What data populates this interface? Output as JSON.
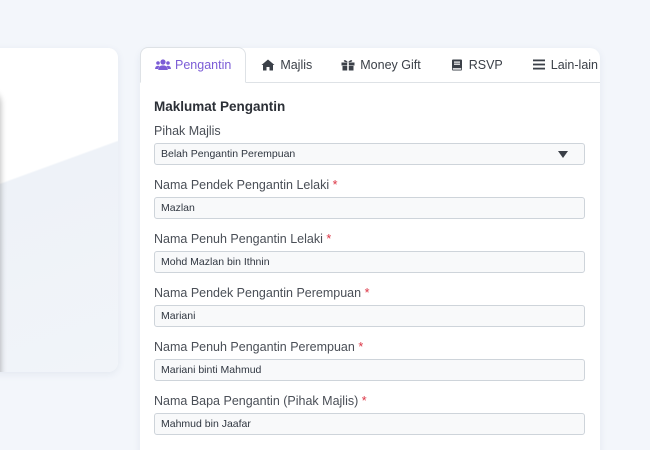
{
  "tabs": [
    {
      "label": "Pengantin",
      "icon": "users-icon",
      "active": true
    },
    {
      "label": "Majlis",
      "icon": "home-icon",
      "active": false
    },
    {
      "label": "Money Gift",
      "icon": "gift-icon",
      "active": false
    },
    {
      "label": "RSVP",
      "icon": "book-icon",
      "active": false
    },
    {
      "label": "Lain-lain",
      "icon": "bars-icon",
      "active": false
    }
  ],
  "colors": {
    "accent": "#7b5cd6",
    "required": "#dc3545"
  },
  "form": {
    "section_title": "Maklumat Pengantin",
    "pihak_majlis": {
      "label": "Pihak Majlis",
      "value": "Belah Pengantin Perempuan"
    },
    "fields": [
      {
        "label": "Nama Pendek Pengantin Lelaki",
        "required_mark": "*",
        "value": "Mazlan"
      },
      {
        "label": "Nama Penuh Pengantin Lelaki",
        "required_mark": "*",
        "value": "Mohd Mazlan bin Ithnin"
      },
      {
        "label": "Nama Pendek Pengantin Perempuan",
        "required_mark": "*",
        "value": "Mariani"
      },
      {
        "label": "Nama Penuh Pengantin Perempuan",
        "required_mark": "*",
        "value": "Mariani binti Mahmud"
      },
      {
        "label": "Nama Bapa Pengantin (Pihak Majlis)",
        "required_mark": "*",
        "value": "Mahmud bin Jaafar"
      }
    ]
  }
}
